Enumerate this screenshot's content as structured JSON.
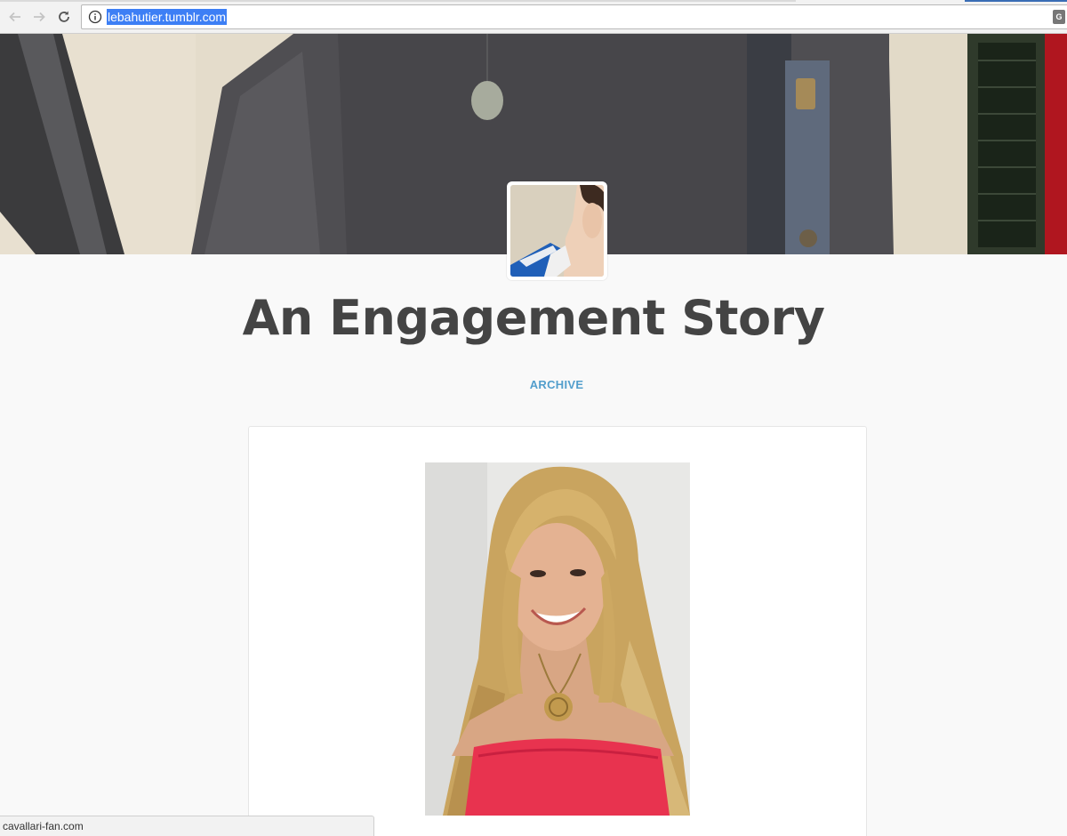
{
  "browser": {
    "url": "lebahutier.tumblr.com",
    "status_url": "cavallari-fan.com"
  },
  "blog": {
    "title": "An Engagement Story",
    "archive_label": "ARCHIVE"
  },
  "colors": {
    "accent_link": "#529ecc",
    "title_text": "#444444",
    "url_highlight": "#3d7ff5"
  }
}
